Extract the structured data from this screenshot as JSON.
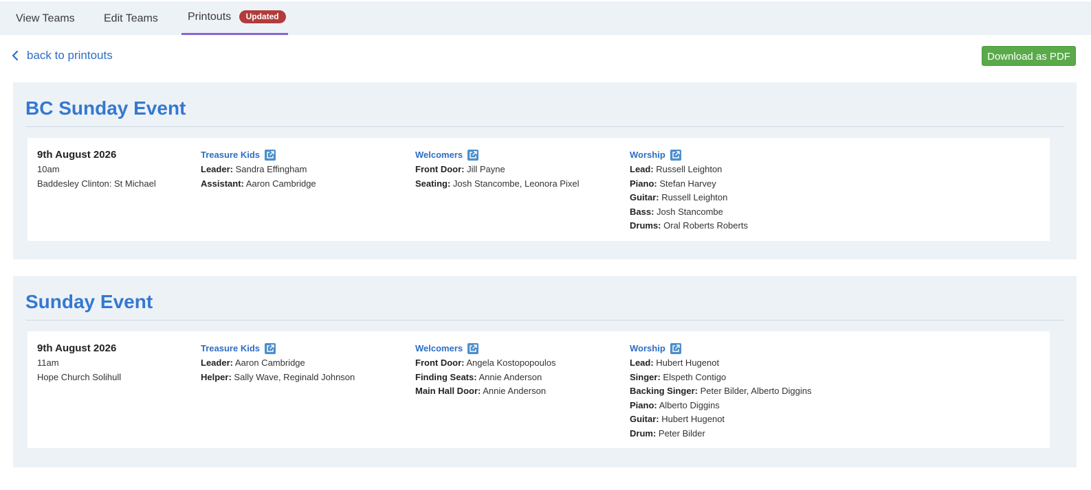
{
  "tabs": [
    {
      "label": "View Teams"
    },
    {
      "label": "Edit Teams"
    },
    {
      "label": "Printouts",
      "badge": "Updated"
    }
  ],
  "back_link": "back to printouts",
  "download_button": "Download as PDF",
  "colors": {
    "accent": "#3478d0",
    "tab_underline": "#8a63d2",
    "badge": "#b23b3b",
    "button": "#5aaa4a"
  },
  "events": [
    {
      "title": "BC Sunday Event",
      "date": "9th August 2026",
      "time": "10am",
      "location": "Baddesley Clinton: St Michael",
      "teams": [
        {
          "name": "Treasure Kids",
          "roles": [
            {
              "role": "Leader:",
              "people": "Sandra Effingham"
            },
            {
              "role": "Assistant:",
              "people": "Aaron Cambridge"
            }
          ]
        },
        {
          "name": "Welcomers",
          "roles": [
            {
              "role": "Front Door:",
              "people": "Jill Payne"
            },
            {
              "role": "Seating:",
              "people": "Josh Stancombe, Leonora Pixel"
            }
          ]
        },
        {
          "name": "Worship",
          "roles": [
            {
              "role": "Lead:",
              "people": "Russell Leighton"
            },
            {
              "role": "Piano:",
              "people": "Stefan Harvey"
            },
            {
              "role": "Guitar:",
              "people": "Russell Leighton"
            },
            {
              "role": "Bass:",
              "people": "Josh Stancombe"
            },
            {
              "role": "Drums:",
              "people": "Oral Roberts Roberts"
            }
          ]
        }
      ]
    },
    {
      "title": "Sunday Event",
      "date": "9th August 2026",
      "time": "11am",
      "location": "Hope Church Solihull",
      "teams": [
        {
          "name": "Treasure Kids",
          "roles": [
            {
              "role": "Leader:",
              "people": "Aaron Cambridge"
            },
            {
              "role": "Helper:",
              "people": "Sally Wave, Reginald Johnson"
            }
          ]
        },
        {
          "name": "Welcomers",
          "roles": [
            {
              "role": "Front Door:",
              "people": "Angela Kostopopoulos"
            },
            {
              "role": "Finding Seats:",
              "people": "Annie Anderson"
            },
            {
              "role": "Main Hall Door:",
              "people": "Annie Anderson"
            }
          ]
        },
        {
          "name": "Worship",
          "roles": [
            {
              "role": "Lead:",
              "people": "Hubert Hugenot"
            },
            {
              "role": "Singer:",
              "people": "Elspeth Contigo"
            },
            {
              "role": "Backing Singer:",
              "people": "Peter Bilder, Alberto Diggins"
            },
            {
              "role": "Piano:",
              "people": "Alberto Diggins"
            },
            {
              "role": "Guitar:",
              "people": "Hubert Hugenot"
            },
            {
              "role": "Drum:",
              "people": "Peter Bilder"
            }
          ]
        }
      ]
    }
  ]
}
